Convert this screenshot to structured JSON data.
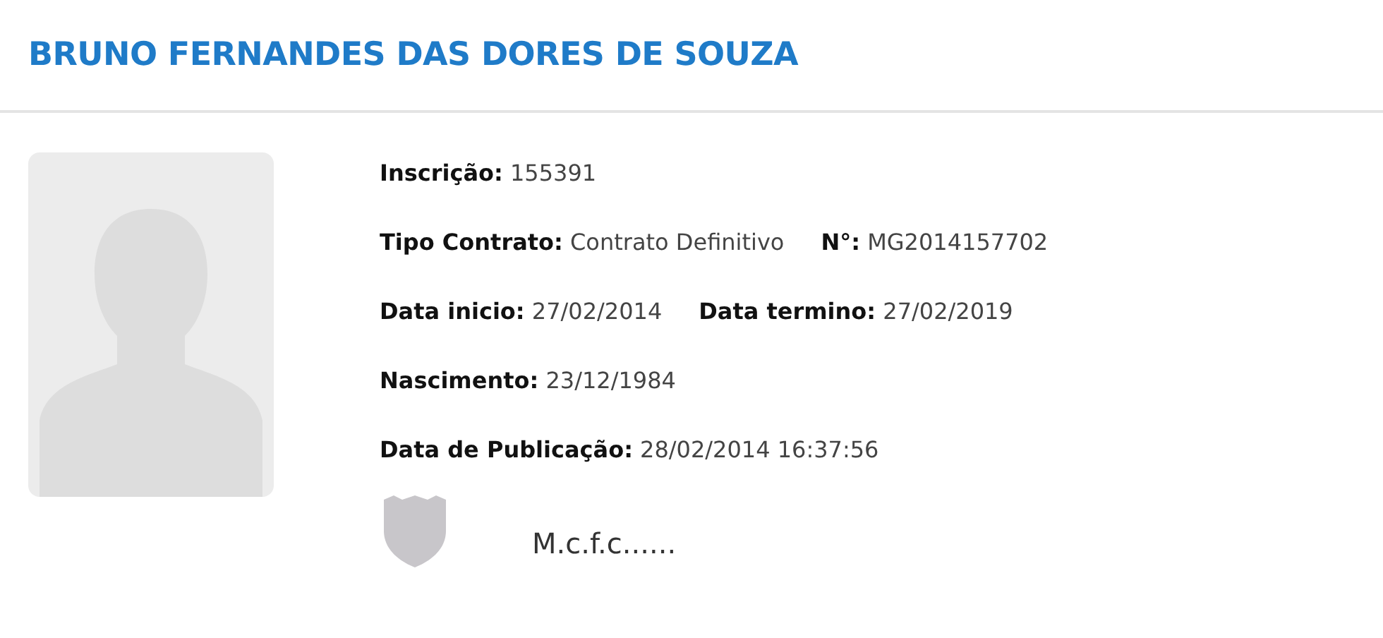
{
  "title": "BRUNO FERNANDES DAS DORES DE SOUZA",
  "rows": [
    [
      {
        "label": "Inscrição:",
        "value": "155391"
      }
    ],
    [
      {
        "label": "Tipo Contrato:",
        "value": "Contrato Definitivo"
      },
      {
        "label": "N°:",
        "value": "MG2014157702"
      }
    ],
    [
      {
        "label": "Data inicio:",
        "value": "27/02/2014"
      },
      {
        "label": "Data termino:",
        "value": "27/02/2019"
      }
    ],
    [
      {
        "label": "Nascimento:",
        "value": "23/12/1984"
      }
    ],
    [
      {
        "label": "Data de Publicação:",
        "value": "28/02/2014 16:37:56"
      }
    ]
  ],
  "club": {
    "name": "M.c.f.c......"
  }
}
